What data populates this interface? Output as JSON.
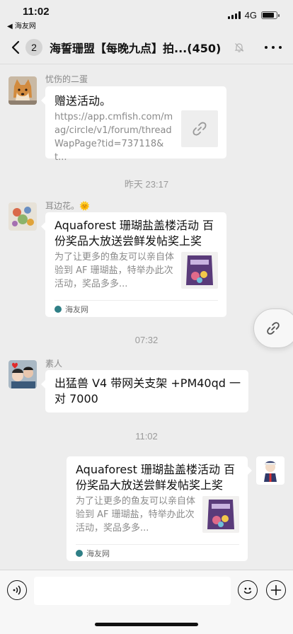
{
  "status": {
    "time": "11:02",
    "back_app": "◀ 海友网",
    "network": "4G",
    "battery_level": 0.85
  },
  "nav": {
    "unread_count": "2",
    "title": "海誓珊盟【每晚九点】拍...",
    "member_count": "(450)"
  },
  "messages": [
    {
      "sender": "忧伤的二蛋",
      "title": "赠送活动。",
      "link": "https://app.cmfish.com/mag/circle/v1/forum/threadWapPage?tid=737118&t..."
    },
    {
      "sender": "耳边花。🌞",
      "title": "Aquaforest 珊瑚盐盖楼活动 百份奖品大放送尝鲜发帖奖上奖",
      "desc": "为了让更多的鱼友可以亲自体验到 AF 珊瑚盐，特举办此次活动，奖品多多...",
      "source": "海友网"
    },
    {
      "sender": "素人",
      "text": "出猛兽 V4 带网关支架 +PM40qd 一对 7000"
    },
    {
      "title": "Aquaforest 珊瑚盐盖楼活动 百份奖品大放送尝鲜发帖奖上奖",
      "desc": "为了让更多的鱼友可以亲自体验到 AF 珊瑚盐，特举办此次活动，奖品多多...",
      "source": "海友网"
    }
  ],
  "timestamps": [
    "昨天 23:17",
    "07:32",
    "11:02"
  ],
  "icons": {
    "back": "chevron-left-icon",
    "mute": "bell-slash-icon",
    "more": "more-dots-icon",
    "link": "link-icon",
    "voice": "voice-icon",
    "emoji": "emoji-icon",
    "add": "plus-icon"
  },
  "colors": {
    "background": "#ededed",
    "bubble": "#ffffff",
    "source_logo": "#2f7f86"
  }
}
